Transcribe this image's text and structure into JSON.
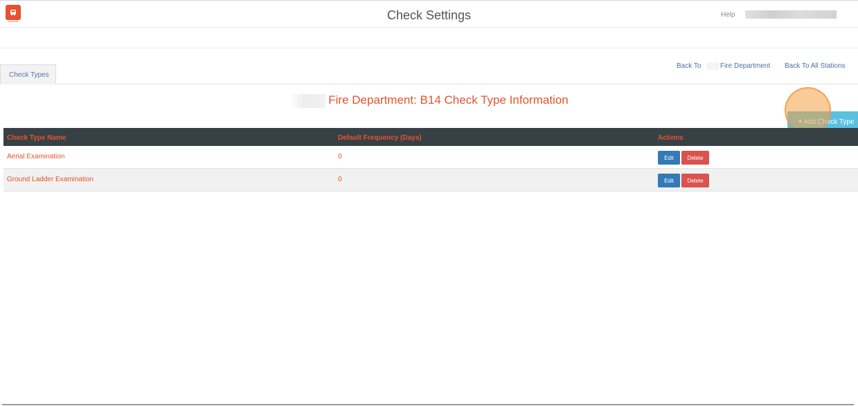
{
  "header": {
    "title": "Check Settings",
    "help_label": "Help",
    "logo_text": "FIREWISE"
  },
  "tabs": [
    {
      "label": "Check Types"
    }
  ],
  "nav": {
    "back_to_label": "Back To",
    "department_link": "Fire Department",
    "all_stations_link": "Back To All Stations"
  },
  "section": {
    "title": "Fire Department: B14 Check Type Information",
    "add_button_label": "Add Check Type"
  },
  "table": {
    "headers": [
      "Check Type Name",
      "Default Frequency (Days)",
      "Actions"
    ],
    "rows": [
      {
        "name": "Aerial Examination",
        "frequency": "0"
      },
      {
        "name": "Ground Ladder Examination",
        "frequency": "0"
      }
    ],
    "edit_label": "Edit",
    "delete_label": "Delete"
  },
  "colors": {
    "accent": "#e5532d",
    "header_dark": "#374145",
    "info_button": "#5bc0de",
    "edit_button": "#337ab7",
    "delete_button": "#d9534f"
  }
}
